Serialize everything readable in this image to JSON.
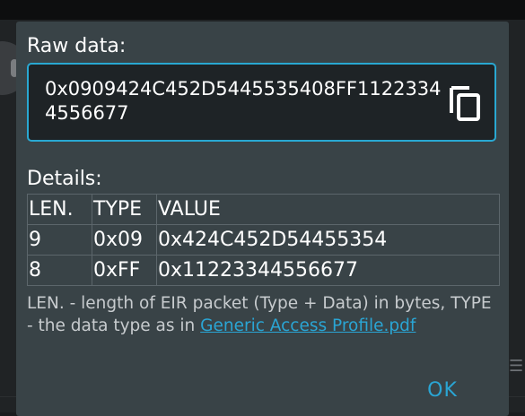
{
  "dialog": {
    "raw_label": "Raw data:",
    "raw_value": "0x0909424C452D5445535408FF11223344556677",
    "copy_icon": "copy-icon",
    "details_label": "Details:",
    "table": {
      "headers": [
        "LEN.",
        "TYPE",
        "VALUE"
      ],
      "rows": [
        [
          "9",
          "0x09",
          "0x424C452D54455354"
        ],
        [
          "8",
          "0xFF",
          "0x11223344556677"
        ]
      ]
    },
    "footnote_text": "LEN. - length of EIR packet (Type + Data) in bytes, TYPE - the data type as in ",
    "footnote_link": "Generic Access Profile.pdf",
    "ok_label": "OK"
  },
  "colors": {
    "accent": "#2aa5d4",
    "dialog_bg": "#394347",
    "field_bg": "#1e2326",
    "text": "#ffffff"
  }
}
